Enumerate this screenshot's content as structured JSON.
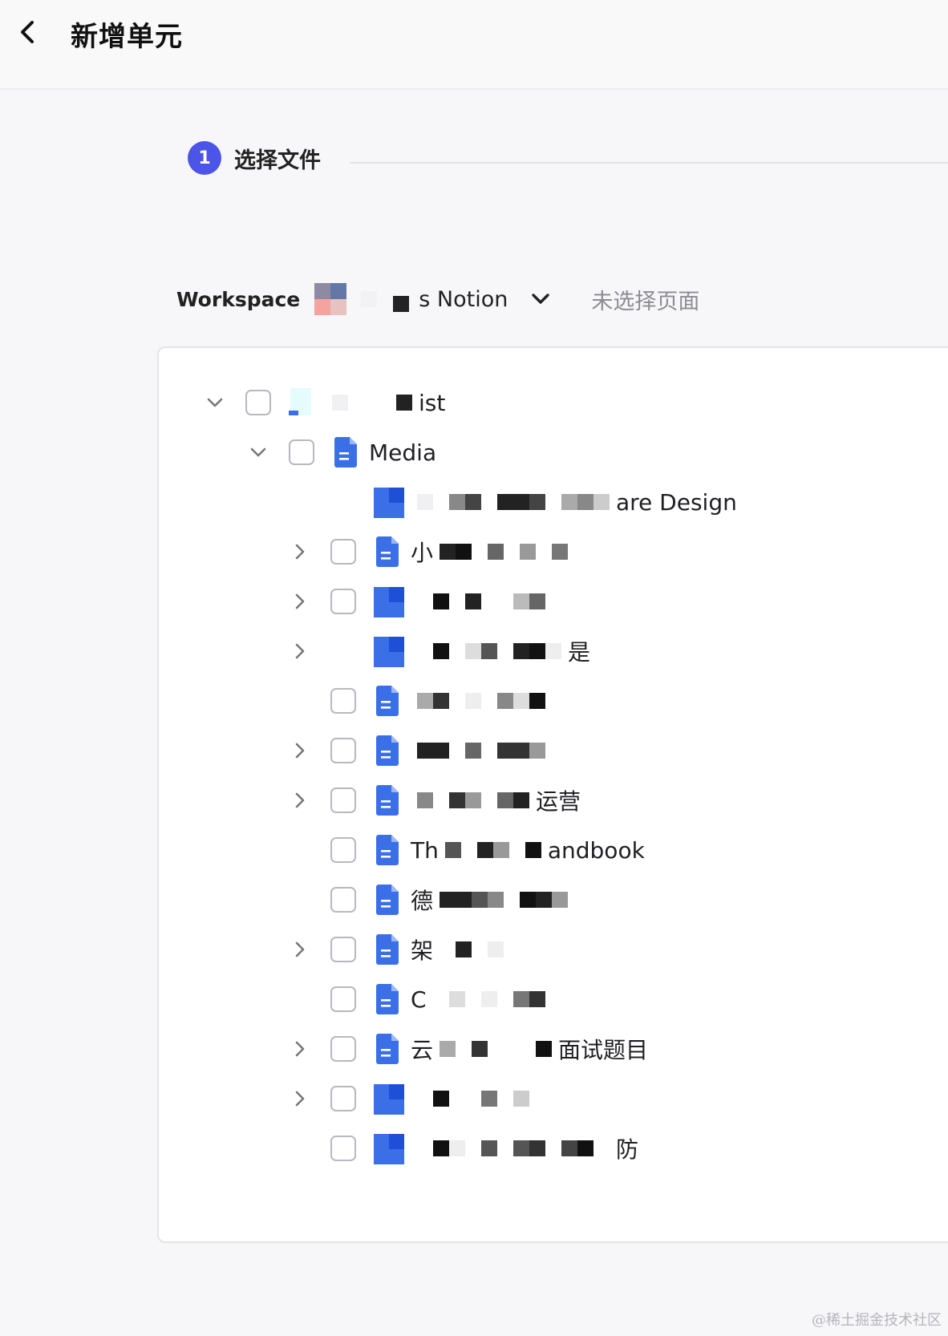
{
  "header": {
    "title": "新增单元"
  },
  "step": {
    "number": "1",
    "label": "选择文件"
  },
  "workspace": {
    "label": "Workspace",
    "name_visible": "s Notion",
    "status": "未选择页面"
  },
  "tree": {
    "root": {
      "label_visible": "ist"
    },
    "media": {
      "label": "Media"
    },
    "items": [
      {
        "prefix": "",
        "suffix": "are Design"
      },
      {
        "prefix": "小",
        "suffix": ""
      },
      {
        "prefix": "",
        "suffix": ""
      },
      {
        "prefix": "",
        "suffix": "是"
      },
      {
        "prefix": "",
        "suffix": ""
      },
      {
        "prefix": "",
        "suffix": ""
      },
      {
        "prefix": "",
        "suffix": "运营"
      },
      {
        "prefix": "Th",
        "suffix": "andbook"
      },
      {
        "prefix": "德",
        "suffix": ""
      },
      {
        "prefix": "架",
        "suffix": ""
      },
      {
        "prefix": "C",
        "suffix": ""
      },
      {
        "prefix": "云",
        "suffix": "面试题目"
      },
      {
        "prefix": "",
        "suffix": ""
      },
      {
        "prefix": "",
        "suffix": "防"
      }
    ]
  },
  "watermark": "@稀土掘金技术社区",
  "colors": {
    "accent": "#4c55e8",
    "doc_blue": "#3b6fe8"
  }
}
